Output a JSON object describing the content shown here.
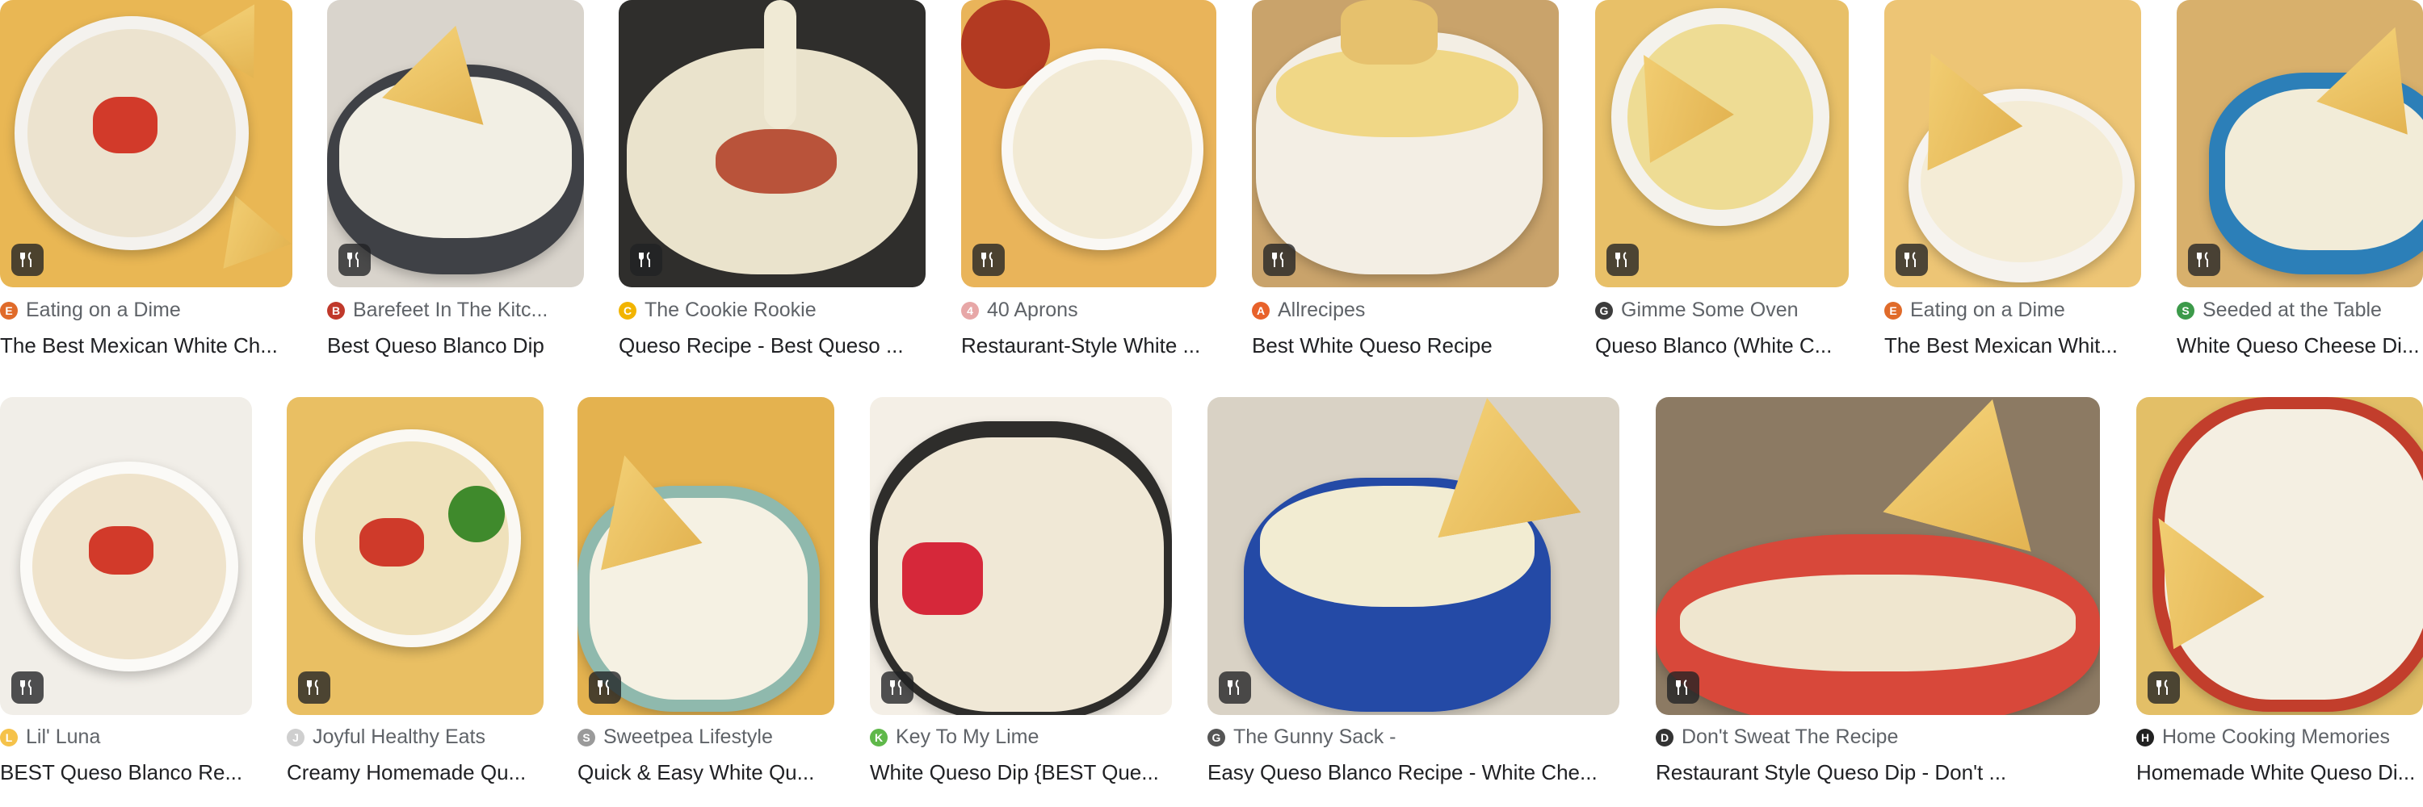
{
  "results": [
    {
      "source": "Eating on a Dime",
      "title": "The Best Mexican White Ch...",
      "icon": "eating-on-a-dime-favicon",
      "color": "#e06b2a"
    },
    {
      "source": "Barefeet In The Kitc...",
      "title": "Best Queso Blanco Dip",
      "icon": "barefeet-favicon",
      "color": "#c0392b"
    },
    {
      "source": "The Cookie Rookie",
      "title": "Queso Recipe - Best Queso ...",
      "icon": "cookie-rookie-favicon",
      "color": "#f2b400"
    },
    {
      "source": "40 Aprons",
      "title": "Restaurant-Style White ...",
      "icon": "40-aprons-favicon",
      "color": "#e7a7a7"
    },
    {
      "source": "Allrecipes",
      "title": "Best White Queso Recipe",
      "icon": "allrecipes-favicon",
      "color": "#e8622b"
    },
    {
      "source": "Gimme Some Oven",
      "title": "Queso Blanco (White C...",
      "icon": "fork-knife-favicon",
      "color": "#3c3c3c"
    },
    {
      "source": "Eating on a Dime",
      "title": "The Best Mexican Whit...",
      "icon": "eating-on-a-dime-favicon",
      "color": "#e06b2a"
    },
    {
      "source": "Seeded at the Table",
      "title": "White Queso Cheese Di...",
      "icon": "seeded-favicon",
      "color": "#3c9a4a"
    },
    {
      "source": "Lil' Luna",
      "title": "BEST Queso Blanco Re...",
      "icon": "lil-luna-favicon",
      "color": "#f5c24a"
    },
    {
      "source": "Joyful Healthy Eats",
      "title": "Creamy Homemade Qu...",
      "icon": "joyful-healthy-eats-favicon",
      "color": "#cfcfcf"
    },
    {
      "source": "Sweetpea Lifestyle",
      "title": "Quick & Easy White Qu...",
      "icon": "sweetpea-favicon",
      "color": "#9a9a9a"
    },
    {
      "source": "Key To My Lime",
      "title": "White Queso Dip {BEST Que...",
      "icon": "key-to-my-lime-favicon",
      "color": "#5fb84a"
    },
    {
      "source": "The Gunny Sack -",
      "title": "Easy Queso Blanco Recipe - White Che...",
      "icon": "gunny-sack-favicon",
      "color": "#555555"
    },
    {
      "source": "Don't Sweat The Recipe",
      "title": "Restaurant Style Queso Dip - Don't ...",
      "icon": "dont-sweat-favicon",
      "color": "#333333"
    },
    {
      "source": "Home Cooking Memories",
      "title": "Homemade White Queso Di...",
      "icon": "home-cooking-memories-favicon",
      "color": "#222222"
    }
  ],
  "badge_icon": "fork-knife-icon"
}
